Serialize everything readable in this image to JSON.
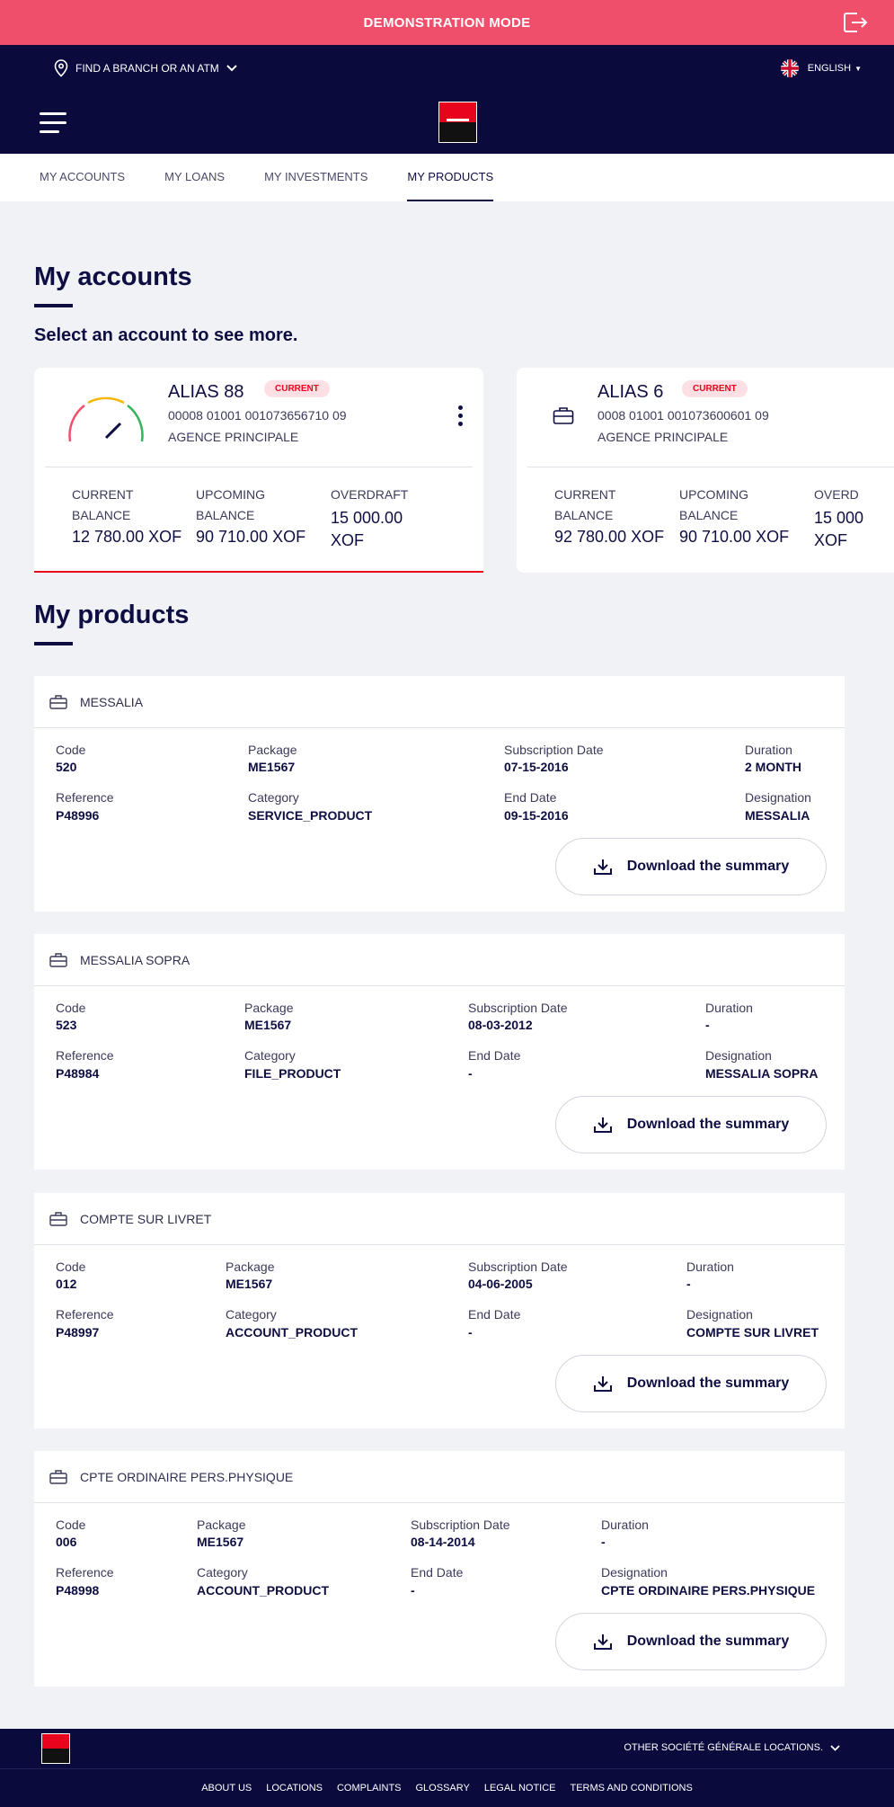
{
  "demo": {
    "title": "DEMONSTRATION MODE"
  },
  "topbar": {
    "finder_label": "FIND A BRANCH OR AN ATM",
    "language": "ENGLISH"
  },
  "tabs": [
    {
      "label": "MY ACCOUNTS"
    },
    {
      "label": "MY LOANS"
    },
    {
      "label": "MY INVESTMENTS"
    },
    {
      "label": "MY PRODUCTS"
    }
  ],
  "accounts_section": {
    "title": "My accounts",
    "subtitle": "Select an account to see more."
  },
  "accounts": [
    {
      "alias": "ALIAS 88",
      "badge": "CURRENT",
      "number": "00008 01001 001073656710 09",
      "agency": "AGENCE PRINCIPALE",
      "current_label": "CURRENT BALANCE",
      "current_value": "12 780.00 XOF",
      "upcoming_label": "UPCOMING BALANCE",
      "upcoming_value": "90 710.00 XOF",
      "overdraft_label": "OVERDRAFT",
      "overdraft_value": "15 000.00 XOF"
    },
    {
      "alias": "ALIAS 6",
      "badge": "CURRENT",
      "number": "0008 01001 001073600601 09",
      "agency": "AGENCE PRINCIPALE",
      "current_label": "CURRENT BALANCE",
      "current_value": "92 780.00 XOF",
      "upcoming_label": "UPCOMING BALANCE",
      "upcoming_value": "90 710.00 XOF",
      "overdraft_label": "OVERD",
      "overdraft_value": "15 000 XOF"
    }
  ],
  "products_section": {
    "title": "My products"
  },
  "field_labels": {
    "code": "Code",
    "package": "Package",
    "subscription": "Subscription Date",
    "duration": "Duration",
    "reference": "Reference",
    "category": "Category",
    "end": "End Date",
    "designation": "Designation"
  },
  "download_label": "Download the summary",
  "products": [
    {
      "name": "MESSALIA",
      "code": "520",
      "package": "ME1567",
      "subscription": "07-15-2016",
      "duration": "2 MONTH",
      "reference": "P48996",
      "category": "SERVICE_PRODUCT",
      "end": "09-15-2016",
      "designation": "MESSALIA"
    },
    {
      "name": "MESSALIA SOPRA",
      "code": "523",
      "package": "ME1567",
      "subscription": "08-03-2012",
      "duration": "-",
      "reference": "P48984",
      "category": "FILE_PRODUCT",
      "end": "-",
      "designation": "MESSALIA SOPRA"
    },
    {
      "name": "COMPTE SUR LIVRET",
      "code": "012",
      "package": "ME1567",
      "subscription": "04-06-2005",
      "duration": "-",
      "reference": "P48997",
      "category": "ACCOUNT_PRODUCT",
      "end": "-",
      "designation": "COMPTE SUR LIVRET"
    },
    {
      "name": "CPTE ORDINAIRE PERS.PHYSIQUE",
      "code": "006",
      "package": "ME1567",
      "subscription": "08-14-2014",
      "duration": "-",
      "reference": "P48998",
      "category": "ACCOUNT_PRODUCT",
      "end": "-",
      "designation": "CPTE ORDINAIRE PERS.PHYSIQUE"
    }
  ],
  "footer": {
    "other_locations": "OTHER SOCIÉTÉ GÉNÉRALE LOCATIONS.",
    "links": [
      "ABOUT US",
      "LOCATIONS",
      "COMPLAINTS",
      "GLOSSARY",
      "LEGAL NOTICE",
      "TERMS AND CONDITIONS"
    ]
  },
  "colors": {
    "accent": "#ef4f6a",
    "navy": "#0a0a3d",
    "brand_red": "#e9041e"
  }
}
